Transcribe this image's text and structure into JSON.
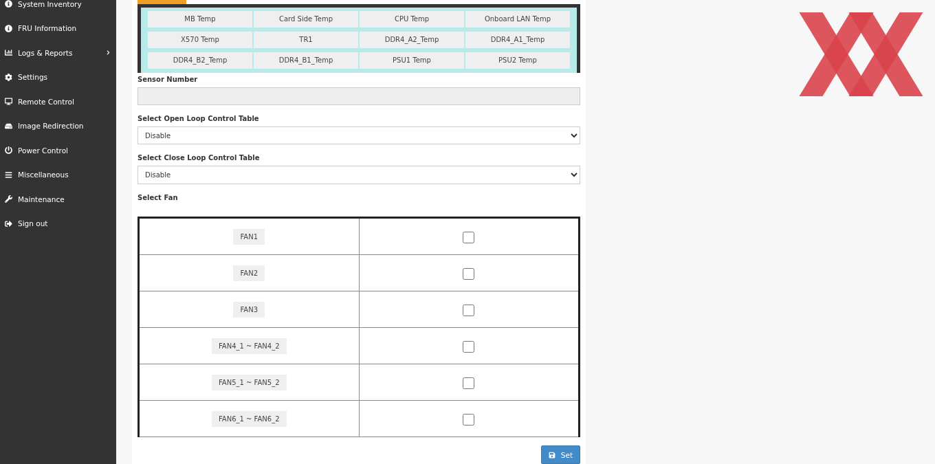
{
  "sidebar": {
    "items": [
      {
        "label": "System Inventory",
        "expandable": false
      },
      {
        "label": "FRU Information",
        "expandable": false
      },
      {
        "label": "Logs & Reports",
        "expandable": true
      },
      {
        "label": "Settings",
        "expandable": false
      },
      {
        "label": "Remote Control",
        "expandable": false
      },
      {
        "label": "Image Redirection",
        "expandable": false
      },
      {
        "label": "Power Control",
        "expandable": false
      },
      {
        "label": "Miscellaneous",
        "expandable": false
      },
      {
        "label": "Maintenance",
        "expandable": false
      },
      {
        "label": "Sign out",
        "expandable": false
      }
    ]
  },
  "sensors": [
    "MB Temp",
    "Card Side Temp",
    "CPU Temp",
    "Onboard LAN Temp",
    "X570 Temp",
    "TR1",
    "DDR4_A2_Temp",
    "DDR4_A1_Temp",
    "DDR4_B2_Temp",
    "DDR4_B1_Temp",
    "PSU1 Temp",
    "PSU2 Temp"
  ],
  "sensor_number": {
    "label": "Sensor Number"
  },
  "open_loop": {
    "label": "Select Open Loop Control Table",
    "value": "Disable"
  },
  "close_loop": {
    "label": "Select Close Loop Control Table",
    "value": "Disable"
  },
  "fan_label": "Select Fan",
  "fans": [
    {
      "label": "FAN1",
      "checked": false
    },
    {
      "label": "FAN2",
      "checked": false
    },
    {
      "label": "FAN3",
      "checked": false
    },
    {
      "label": "FAN4_1 ~ FAN4_2",
      "checked": false
    },
    {
      "label": "FAN5_1 ~ FAN5_2",
      "checked": false
    },
    {
      "label": "FAN6_1 ~ FAN6_2",
      "checked": false
    }
  ],
  "set_button": "Set"
}
